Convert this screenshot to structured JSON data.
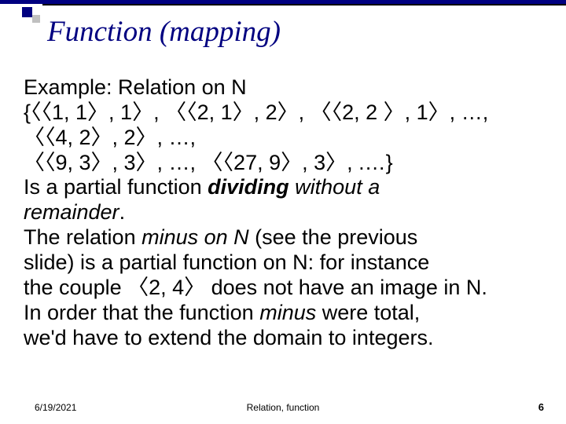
{
  "slide": {
    "title": "Function (mapping)",
    "line1": "Example: Relation on N",
    "line2": "{〈〈1, 1〉, 1〉, 〈〈2, 1〉, 2〉,  〈〈2, 2 〉, 1〉,  …,  〈〈4, 2〉, 2〉,  …,",
    "line3": "〈〈9, 3〉, 3〉,  …,  〈〈27, 9〉, 3〉,  .…}",
    "line4a": "Is a partial function ",
    "line4b": "dividing",
    "line4c": " without a",
    "line5a": "remainder",
    "line5b": ".",
    "line6a": "The relation ",
    "line6b": "minus on N",
    "line6c": " (see the previous",
    "line7": "slide) is a partial function on N: for instance",
    "line8": "the couple 〈2, 4〉 does not have an image in N.",
    "line9a": "In order that the function ",
    "line9b": "minus",
    "line9c": " were total,",
    "line10": "we'd have to extend the domain to integers."
  },
  "footer": {
    "date": "6/19/2021",
    "center": "Relation, function",
    "page": "6"
  }
}
